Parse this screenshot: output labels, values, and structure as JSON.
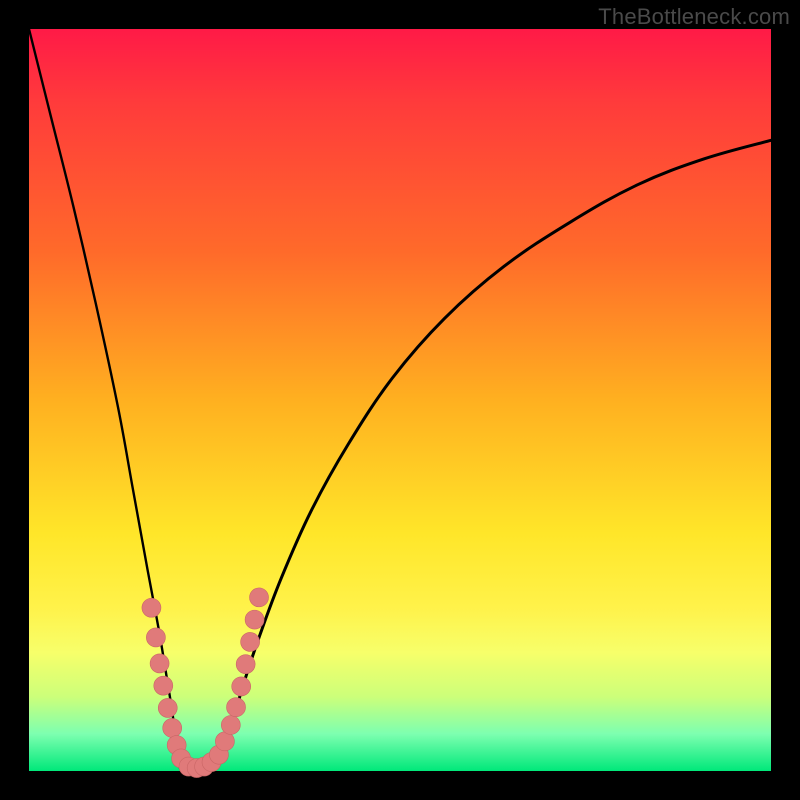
{
  "attribution": "TheBottleneck.com",
  "colors": {
    "page_background": "#000000",
    "gradient_top": "#ff1a47",
    "gradient_bottom": "#00e87a",
    "curve_stroke": "#000000",
    "dot_fill": "#e07a7a",
    "dot_stroke": "#c96666",
    "attribution_text": "#4a4a4a"
  },
  "chart_data": {
    "type": "line",
    "title": "",
    "xlabel": "",
    "ylabel": "",
    "xlim": [
      0,
      100
    ],
    "ylim": [
      0,
      100
    ],
    "grid": false,
    "legend": false,
    "annotations": [
      "TheBottleneck.com"
    ],
    "series": [
      {
        "name": "left-curve",
        "x": [
          0,
          3,
          6,
          9,
          12,
          14,
          16,
          17.5,
          18.5,
          19.3,
          19.8,
          20,
          20.3,
          20.7,
          21.3,
          22,
          23,
          24,
          25
        ],
        "values": [
          100,
          88,
          76,
          63,
          49,
          38,
          27,
          19,
          13,
          8,
          4,
          1.5,
          0.5,
          0,
          0,
          0.3,
          0.6,
          1,
          1.4
        ]
      },
      {
        "name": "right-curve",
        "x": [
          25,
          26,
          27.5,
          29,
          31,
          34,
          38,
          43,
          49,
          56,
          64,
          73,
          82,
          91,
          100
        ],
        "values": [
          1.4,
          3,
          7,
          12,
          18,
          26,
          35,
          44,
          53,
          61,
          68,
          74,
          79,
          82.5,
          85
        ]
      }
    ],
    "points": [
      {
        "name": "cluster-dot",
        "x": 16.5,
        "y": 22
      },
      {
        "name": "cluster-dot",
        "x": 17.1,
        "y": 18
      },
      {
        "name": "cluster-dot",
        "x": 17.6,
        "y": 14.5
      },
      {
        "name": "cluster-dot",
        "x": 18.1,
        "y": 11.5
      },
      {
        "name": "cluster-dot",
        "x": 18.7,
        "y": 8.5
      },
      {
        "name": "cluster-dot",
        "x": 19.3,
        "y": 5.8
      },
      {
        "name": "cluster-dot",
        "x": 19.9,
        "y": 3.5
      },
      {
        "name": "cluster-dot",
        "x": 20.5,
        "y": 1.7
      },
      {
        "name": "cluster-dot",
        "x": 21.5,
        "y": 0.6
      },
      {
        "name": "cluster-dot",
        "x": 22.6,
        "y": 0.4
      },
      {
        "name": "cluster-dot",
        "x": 23.6,
        "y": 0.6
      },
      {
        "name": "cluster-dot",
        "x": 24.6,
        "y": 1.2
      },
      {
        "name": "cluster-dot",
        "x": 25.6,
        "y": 2.2
      },
      {
        "name": "cluster-dot",
        "x": 26.4,
        "y": 4
      },
      {
        "name": "cluster-dot",
        "x": 27.2,
        "y": 6.2
      },
      {
        "name": "cluster-dot",
        "x": 27.9,
        "y": 8.6
      },
      {
        "name": "cluster-dot",
        "x": 28.6,
        "y": 11.4
      },
      {
        "name": "cluster-dot",
        "x": 29.2,
        "y": 14.4
      },
      {
        "name": "cluster-dot",
        "x": 29.8,
        "y": 17.4
      },
      {
        "name": "cluster-dot",
        "x": 30.4,
        "y": 20.4
      },
      {
        "name": "cluster-dot",
        "x": 31.0,
        "y": 23.4
      }
    ]
  }
}
